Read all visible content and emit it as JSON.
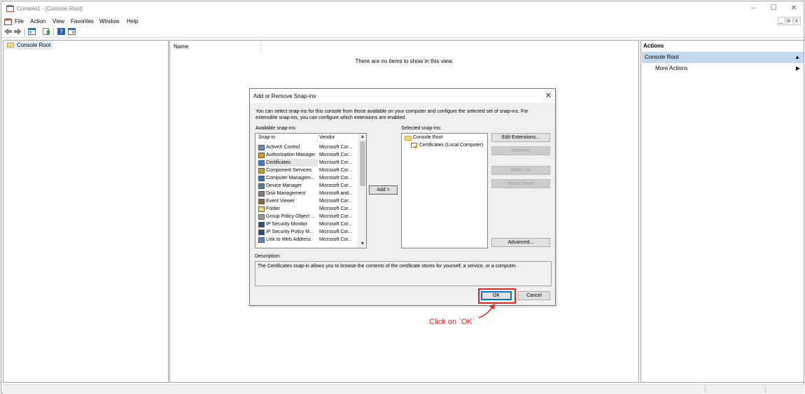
{
  "window": {
    "title": "Console1 - [Console Root]",
    "minimize": "–",
    "maximize": "☐",
    "close": "✕",
    "mdi_controls": [
      "_",
      "&#8599;",
      "x"
    ]
  },
  "menu": {
    "items": [
      "File",
      "Action",
      "View",
      "Favorites",
      "Window",
      "Help"
    ],
    "mdi_min": "_",
    "mdi_restore": "ǝ",
    "mdi_close": "x"
  },
  "tree": {
    "root_label": "Console Root"
  },
  "center": {
    "column_name": "Name",
    "empty_message": "There are no items to show in this view."
  },
  "actions": {
    "title": "Actions",
    "section": "Console Root",
    "section_arrow": "▲",
    "link": "More Actions",
    "link_arrow": "▶"
  },
  "dialog": {
    "title": "Add or Remove Snap-ins",
    "close": "✕",
    "description": "You can select snap-ins for this console from those available on your computer and configure the selected set of snap-ins. For extensible snap-ins, you can configure which extensions are enabled.",
    "available_label": "Available snap-ins:",
    "selected_label": "Selected snap-ins:",
    "columns": {
      "snapin": "Snap-in",
      "vendor": "Vendor"
    },
    "snapins": [
      {
        "name": "ActiveX Control",
        "vendor": "Microsoft Cor...",
        "icon": "activex-icon",
        "color": "#6c8ebf"
      },
      {
        "name": "Authorization Manager",
        "vendor": "Microsoft Cor...",
        "icon": "authorization-icon",
        "color": "#d4a017"
      },
      {
        "name": "Certificates",
        "vendor": "Microsoft Cor...",
        "icon": "certificate-icon",
        "color": "#3a7bd5"
      },
      {
        "name": "Component Services",
        "vendor": "Microsoft Cor...",
        "icon": "component-services-icon",
        "color": "#c8a032"
      },
      {
        "name": "Computer Managem...",
        "vendor": "Microsoft Cor...",
        "icon": "computer-management-icon",
        "color": "#3b6fb6"
      },
      {
        "name": "Device Manager",
        "vendor": "Microsoft Cor...",
        "icon": "device-manager-icon",
        "color": "#5a7d9a"
      },
      {
        "name": "Disk Management",
        "vendor": "Microsoft and...",
        "icon": "disk-management-icon",
        "color": "#7a7a7a"
      },
      {
        "name": "Event Viewer",
        "vendor": "Microsoft Cor...",
        "icon": "event-viewer-icon",
        "color": "#8a6d3b"
      },
      {
        "name": "Folder",
        "vendor": "Microsoft Cor...",
        "icon": "folder-icon",
        "color": "#f6d878"
      },
      {
        "name": "Group Policy Object ...",
        "vendor": "Microsoft Cor...",
        "icon": "group-policy-icon",
        "color": "#9a9a9a"
      },
      {
        "name": "IP Security Monitor",
        "vendor": "Microsoft Cor...",
        "icon": "ip-security-monitor-icon",
        "color": "#2c4f8a"
      },
      {
        "name": "IP Security Policy M...",
        "vendor": "Microsoft Cor...",
        "icon": "ip-security-policy-icon",
        "color": "#2c4f8a"
      },
      {
        "name": "Link to Web Address",
        "vendor": "Microsoft Cor...",
        "icon": "web-link-icon",
        "color": "#5a8ac6"
      }
    ],
    "scroll_up": "▲",
    "scroll_down": "▼",
    "add_button": "Add >",
    "selected_root": "Console Root",
    "selected_child": "Certificates (Local Computer)",
    "buttons": {
      "edit_extensions": "Edit Extensions...",
      "remove": "Remove",
      "move_up": "Move Up",
      "move_down": "Move Down",
      "advanced": "Advanced..."
    },
    "description_label": "Description:",
    "description_text": "The Certificates snap-in allows you to browse the contents of the certificate stores for yourself, a service, or a computer.",
    "ok": "OK",
    "cancel": "Cancel"
  },
  "annotation": {
    "text": "Click on `OK`",
    "color": "#e1261c"
  }
}
